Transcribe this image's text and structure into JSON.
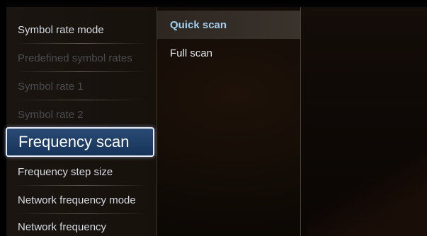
{
  "left_menu": {
    "items": [
      {
        "label": "Symbol rate mode",
        "state": "normal"
      },
      {
        "label": "Predefined symbol rates",
        "state": "disabled"
      },
      {
        "label": "Symbol rate 1",
        "state": "disabled"
      },
      {
        "label": "Symbol rate 2",
        "state": "disabled"
      },
      {
        "label": "Frequency scan",
        "state": "selected"
      },
      {
        "label": "Frequency step size",
        "state": "normal"
      },
      {
        "label": "Network frequency mode",
        "state": "normal"
      },
      {
        "label": "Network frequency",
        "state": "normal"
      }
    ]
  },
  "submenu": {
    "items": [
      {
        "label": "Quick scan",
        "state": "highlighted"
      },
      {
        "label": "Full scan",
        "state": "normal"
      }
    ]
  },
  "colors": {
    "selection_fill": "#1e3f68",
    "selection_border": "#e8eef8",
    "highlight_text": "#9fd0f2",
    "disabled_text": "#4a4c52",
    "normal_text": "#d8dce4"
  }
}
